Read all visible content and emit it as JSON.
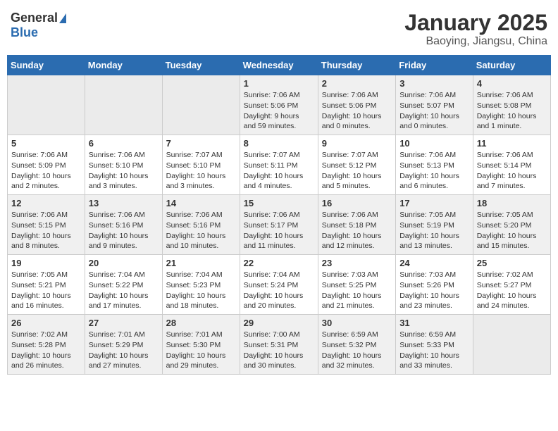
{
  "header": {
    "logo_general": "General",
    "logo_blue": "Blue",
    "month_title": "January 2025",
    "location": "Baoying, Jiangsu, China"
  },
  "weekdays": [
    "Sunday",
    "Monday",
    "Tuesday",
    "Wednesday",
    "Thursday",
    "Friday",
    "Saturday"
  ],
  "weeks": [
    [
      {
        "day": "",
        "info": ""
      },
      {
        "day": "",
        "info": ""
      },
      {
        "day": "",
        "info": ""
      },
      {
        "day": "1",
        "info": "Sunrise: 7:06 AM\nSunset: 5:06 PM\nDaylight: 9 hours\nand 59 minutes."
      },
      {
        "day": "2",
        "info": "Sunrise: 7:06 AM\nSunset: 5:06 PM\nDaylight: 10 hours\nand 0 minutes."
      },
      {
        "day": "3",
        "info": "Sunrise: 7:06 AM\nSunset: 5:07 PM\nDaylight: 10 hours\nand 0 minutes."
      },
      {
        "day": "4",
        "info": "Sunrise: 7:06 AM\nSunset: 5:08 PM\nDaylight: 10 hours\nand 1 minute."
      }
    ],
    [
      {
        "day": "5",
        "info": "Sunrise: 7:06 AM\nSunset: 5:09 PM\nDaylight: 10 hours\nand 2 minutes."
      },
      {
        "day": "6",
        "info": "Sunrise: 7:06 AM\nSunset: 5:10 PM\nDaylight: 10 hours\nand 3 minutes."
      },
      {
        "day": "7",
        "info": "Sunrise: 7:07 AM\nSunset: 5:10 PM\nDaylight: 10 hours\nand 3 minutes."
      },
      {
        "day": "8",
        "info": "Sunrise: 7:07 AM\nSunset: 5:11 PM\nDaylight: 10 hours\nand 4 minutes."
      },
      {
        "day": "9",
        "info": "Sunrise: 7:07 AM\nSunset: 5:12 PM\nDaylight: 10 hours\nand 5 minutes."
      },
      {
        "day": "10",
        "info": "Sunrise: 7:06 AM\nSunset: 5:13 PM\nDaylight: 10 hours\nand 6 minutes."
      },
      {
        "day": "11",
        "info": "Sunrise: 7:06 AM\nSunset: 5:14 PM\nDaylight: 10 hours\nand 7 minutes."
      }
    ],
    [
      {
        "day": "12",
        "info": "Sunrise: 7:06 AM\nSunset: 5:15 PM\nDaylight: 10 hours\nand 8 minutes."
      },
      {
        "day": "13",
        "info": "Sunrise: 7:06 AM\nSunset: 5:16 PM\nDaylight: 10 hours\nand 9 minutes."
      },
      {
        "day": "14",
        "info": "Sunrise: 7:06 AM\nSunset: 5:16 PM\nDaylight: 10 hours\nand 10 minutes."
      },
      {
        "day": "15",
        "info": "Sunrise: 7:06 AM\nSunset: 5:17 PM\nDaylight: 10 hours\nand 11 minutes."
      },
      {
        "day": "16",
        "info": "Sunrise: 7:06 AM\nSunset: 5:18 PM\nDaylight: 10 hours\nand 12 minutes."
      },
      {
        "day": "17",
        "info": "Sunrise: 7:05 AM\nSunset: 5:19 PM\nDaylight: 10 hours\nand 13 minutes."
      },
      {
        "day": "18",
        "info": "Sunrise: 7:05 AM\nSunset: 5:20 PM\nDaylight: 10 hours\nand 15 minutes."
      }
    ],
    [
      {
        "day": "19",
        "info": "Sunrise: 7:05 AM\nSunset: 5:21 PM\nDaylight: 10 hours\nand 16 minutes."
      },
      {
        "day": "20",
        "info": "Sunrise: 7:04 AM\nSunset: 5:22 PM\nDaylight: 10 hours\nand 17 minutes."
      },
      {
        "day": "21",
        "info": "Sunrise: 7:04 AM\nSunset: 5:23 PM\nDaylight: 10 hours\nand 18 minutes."
      },
      {
        "day": "22",
        "info": "Sunrise: 7:04 AM\nSunset: 5:24 PM\nDaylight: 10 hours\nand 20 minutes."
      },
      {
        "day": "23",
        "info": "Sunrise: 7:03 AM\nSunset: 5:25 PM\nDaylight: 10 hours\nand 21 minutes."
      },
      {
        "day": "24",
        "info": "Sunrise: 7:03 AM\nSunset: 5:26 PM\nDaylight: 10 hours\nand 23 minutes."
      },
      {
        "day": "25",
        "info": "Sunrise: 7:02 AM\nSunset: 5:27 PM\nDaylight: 10 hours\nand 24 minutes."
      }
    ],
    [
      {
        "day": "26",
        "info": "Sunrise: 7:02 AM\nSunset: 5:28 PM\nDaylight: 10 hours\nand 26 minutes."
      },
      {
        "day": "27",
        "info": "Sunrise: 7:01 AM\nSunset: 5:29 PM\nDaylight: 10 hours\nand 27 minutes."
      },
      {
        "day": "28",
        "info": "Sunrise: 7:01 AM\nSunset: 5:30 PM\nDaylight: 10 hours\nand 29 minutes."
      },
      {
        "day": "29",
        "info": "Sunrise: 7:00 AM\nSunset: 5:31 PM\nDaylight: 10 hours\nand 30 minutes."
      },
      {
        "day": "30",
        "info": "Sunrise: 6:59 AM\nSunset: 5:32 PM\nDaylight: 10 hours\nand 32 minutes."
      },
      {
        "day": "31",
        "info": "Sunrise: 6:59 AM\nSunset: 5:33 PM\nDaylight: 10 hours\nand 33 minutes."
      },
      {
        "day": "",
        "info": ""
      }
    ]
  ],
  "shaded_rows": [
    0,
    2,
    4
  ],
  "colors": {
    "header_bg": "#2b6cb0",
    "shaded_row": "#f0f0f0",
    "normal_row": "#ffffff"
  }
}
